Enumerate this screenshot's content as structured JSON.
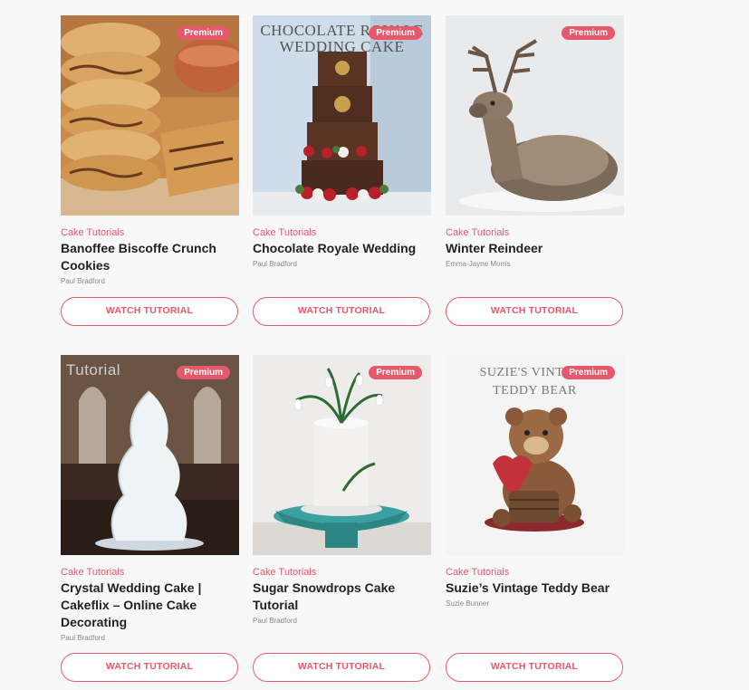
{
  "cards": [
    {
      "badge": "Premium",
      "category": "Cake Tutorials",
      "title": "Banoffee Biscoffe Crunch Cookies",
      "author": "Paul Bradford",
      "button": "WATCH TUTORIAL"
    },
    {
      "badge": "Premium",
      "overlay": [
        "CHOCOLATE ROYALE",
        "WEDDING CAKE"
      ],
      "category": "Cake Tutorials",
      "title": "Chocolate Royale Wedding",
      "author": "Paul Bradford",
      "button": "WATCH TUTORIAL"
    },
    {
      "badge": "Premium",
      "category": "Cake Tutorials",
      "title": "Winter Reindeer",
      "author": "Emma-Jayne Morris",
      "button": "WATCH TUTORIAL"
    },
    {
      "badge": "Premium",
      "overlay": [
        "Tutorial"
      ],
      "category": "Cake Tutorials",
      "title": "Crystal Wedding Cake | Cakeflix – Online Cake Decorating",
      "author": "Paul Bradford",
      "button": "WATCH TUTORIAL"
    },
    {
      "badge": "Premium",
      "category": "Cake Tutorials",
      "title": "Sugar Snowdrops Cake Tutorial",
      "author": "Paul Bradford",
      "button": "WATCH TUTORIAL"
    },
    {
      "badge": "Premium",
      "overlay": [
        "SUZIE'S VINTAGE",
        "TEDDY BEAR"
      ],
      "category": "Cake Tutorials",
      "title": "Suzie’s Vintage Teddy Bear",
      "author": "Suzie Bunner",
      "button": "WATCH TUTORIAL"
    }
  ],
  "colors": {
    "accent": "#e8586b",
    "title": "#222222",
    "author": "#888888",
    "background": "#f8f8f8"
  }
}
